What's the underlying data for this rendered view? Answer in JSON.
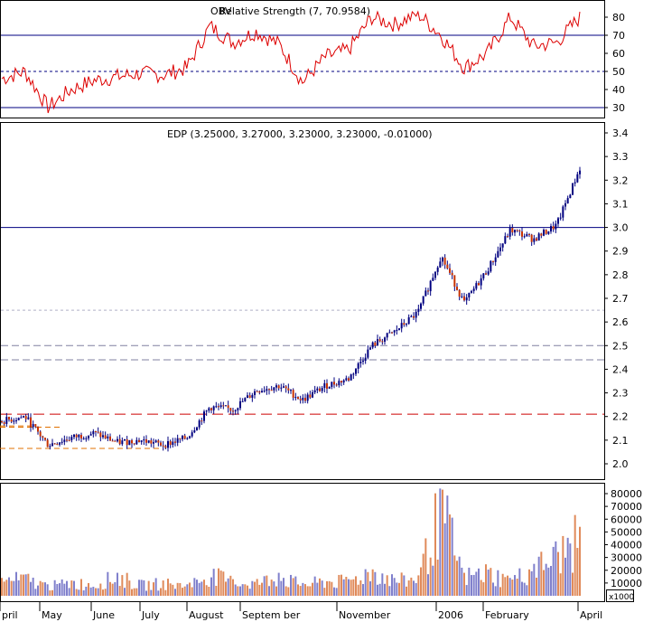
{
  "rsi_panel": {
    "header_a": "OBV",
    "header_b": "Relative Strength (7, 70.9584)",
    "yticks": [
      80,
      70,
      60,
      50,
      40,
      30
    ]
  },
  "price_panel": {
    "header": "EDP (3.25000, 3.27000, 3.23000, 3.23000, -0.01000)",
    "yticks": [
      "3.4",
      "3.3",
      "3.2",
      "3.1",
      "3.0",
      "2.9",
      "2.8",
      "2.7",
      "2.6",
      "2.5",
      "2.4",
      "2.3",
      "2.2",
      "2.1",
      "2.0"
    ]
  },
  "volume_panel": {
    "yticks": [
      "80000",
      "70000",
      "60000",
      "50000",
      "40000",
      "30000",
      "20000",
      "10000"
    ],
    "unit": "x1000"
  },
  "xaxis": {
    "labels": [
      "pril",
      "May",
      "June",
      "July",
      "August",
      "Septem ber",
      "November",
      "2006",
      "February",
      "April"
    ]
  },
  "colors": {
    "frame": "#000000",
    "rsi_line": "#dd0000",
    "guide_blue": "#000080",
    "candle_up": "#000080",
    "candle_down": "#c83200",
    "dash_red": "#cc0000",
    "dash_gray": "#8080a0",
    "dash_light": "#b0b0c8",
    "dash_orange": "#e07000",
    "vol_blue": "#8080cc",
    "vol_orange": "#e08a5a"
  },
  "chart_data": [
    {
      "type": "line",
      "name": "Relative Strength",
      "ylim": [
        25,
        85
      ],
      "reference_lines": [
        70,
        50,
        30
      ],
      "x": [
        "Apr",
        "Apr",
        "May",
        "May",
        "May",
        "Jun",
        "Jun",
        "Jul",
        "Jul",
        "Aug",
        "Aug",
        "Sep",
        "Sep",
        "Oct",
        "Oct",
        "Nov",
        "Nov",
        "Dec",
        "Dec",
        "Jan",
        "Jan",
        "Feb",
        "Feb",
        "Mar",
        "Mar",
        "Apr"
      ],
      "y": [
        46,
        50,
        30,
        40,
        45,
        47,
        49,
        48,
        52,
        75,
        66,
        72,
        65,
        44,
        58,
        62,
        80,
        76,
        82,
        70,
        52,
        60,
        80,
        64,
        66,
        80
      ]
    },
    {
      "type": "candlestick",
      "name": "EDP",
      "ylim": [
        1.95,
        3.42
      ],
      "reference_lines": [
        3.0,
        2.65,
        2.5,
        2.44,
        2.21
      ],
      "x": [
        "Apr",
        "Apr",
        "May",
        "May",
        "May",
        "Jun",
        "Jun",
        "Jul",
        "Jul",
        "Aug",
        "Aug",
        "Sep",
        "Sep",
        "Oct",
        "Oct",
        "Nov",
        "Nov",
        "Dec",
        "Dec",
        "Jan",
        "Jan",
        "Feb",
        "Feb",
        "Mar",
        "Mar",
        "Apr"
      ],
      "close": [
        2.18,
        2.2,
        2.08,
        2.11,
        2.13,
        2.09,
        2.1,
        2.08,
        2.11,
        2.24,
        2.23,
        2.31,
        2.33,
        2.27,
        2.33,
        2.36,
        2.5,
        2.56,
        2.64,
        2.88,
        2.68,
        2.82,
        2.99,
        2.95,
        3.01,
        3.25
      ]
    },
    {
      "type": "bar",
      "name": "Volume",
      "ylim": [
        0,
        85000
      ],
      "x": [
        "Apr",
        "Apr",
        "May",
        "May",
        "May",
        "Jun",
        "Jun",
        "Jul",
        "Jul",
        "Aug",
        "Aug",
        "Sep",
        "Sep",
        "Oct",
        "Oct",
        "Nov",
        "Nov",
        "Dec",
        "Dec",
        "Jan",
        "Jan",
        "Feb",
        "Feb",
        "Mar",
        "Mar",
        "Apr"
      ],
      "values": [
        14000,
        16000,
        9000,
        12000,
        11000,
        18000,
        10000,
        12000,
        9000,
        20000,
        13000,
        12000,
        18000,
        10000,
        14000,
        13000,
        24000,
        14000,
        16000,
        82000,
        18000,
        22000,
        14000,
        25000,
        38000,
        54000
      ]
    }
  ]
}
